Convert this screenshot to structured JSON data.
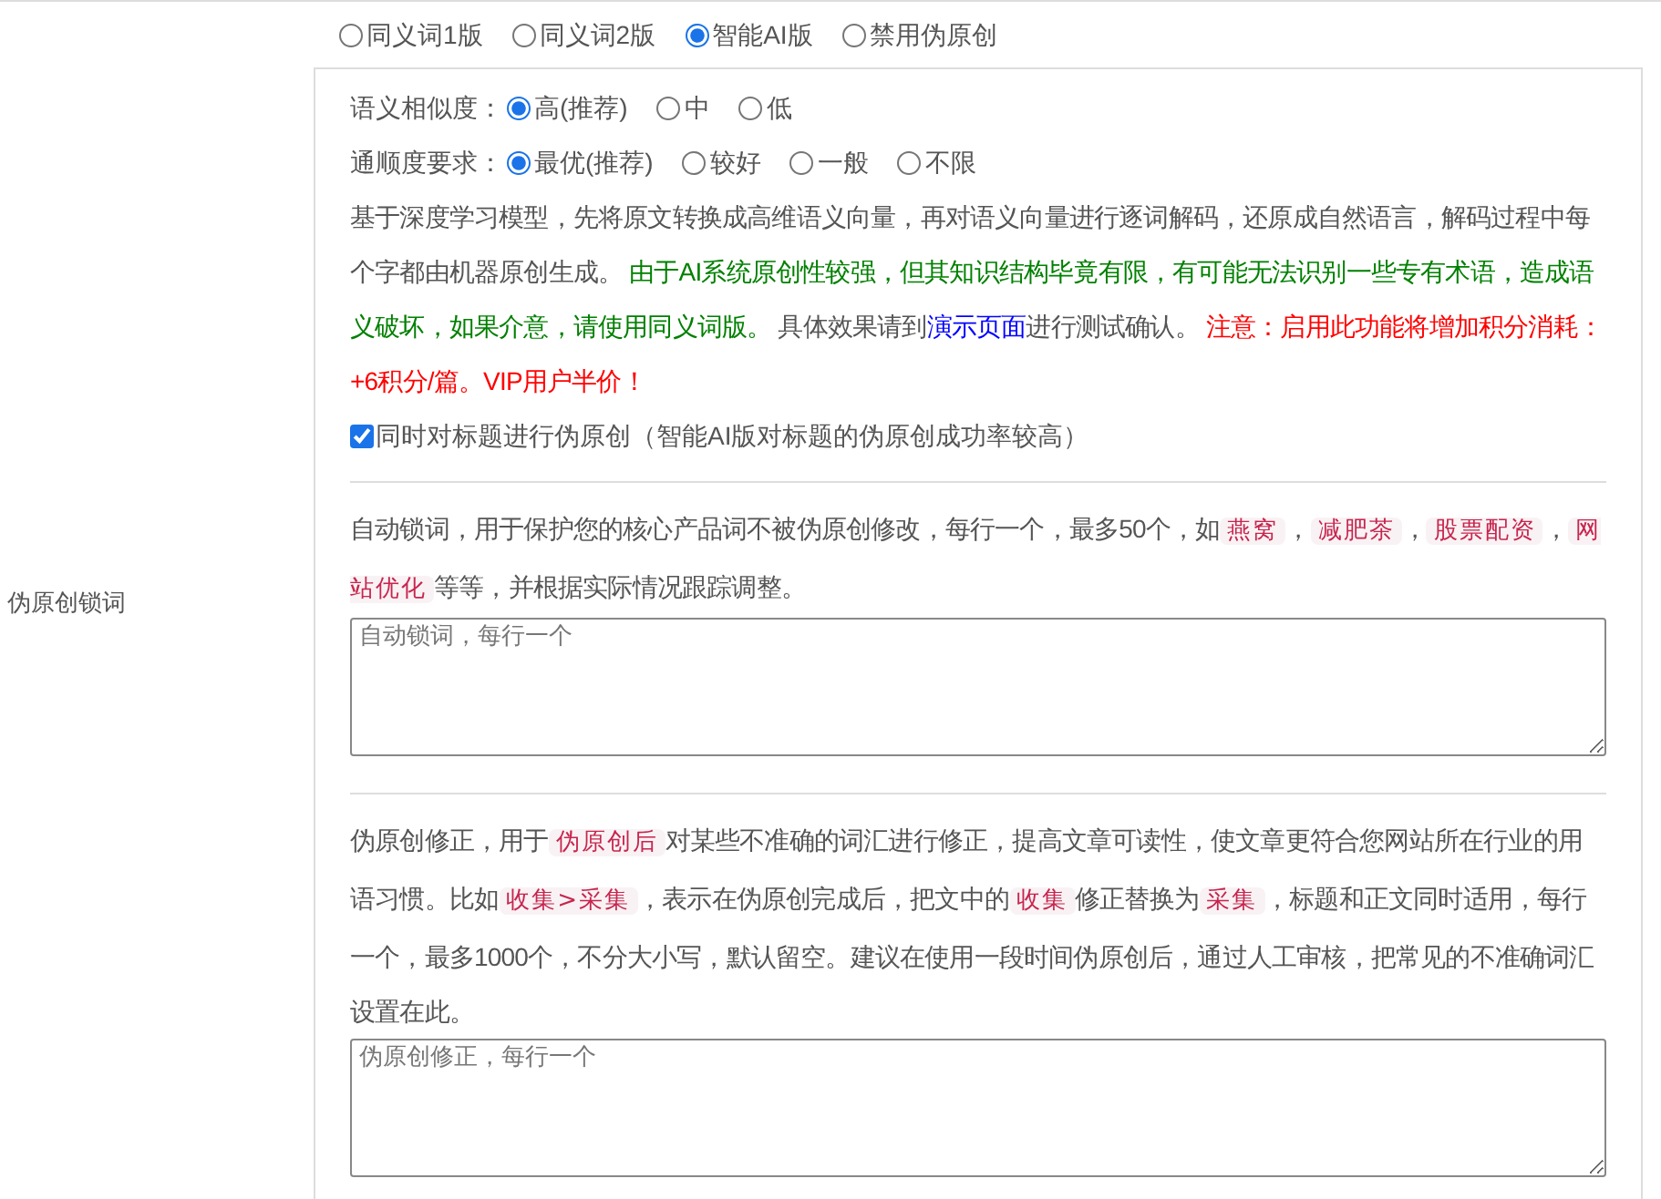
{
  "versions": [
    {
      "label": "同义词1版",
      "selected": false
    },
    {
      "label": "同义词2版",
      "selected": false
    },
    {
      "label": "智能AI版",
      "selected": true
    },
    {
      "label": "禁用伪原创",
      "selected": false
    }
  ],
  "ai_panel": {
    "similarity": {
      "label": "语义相似度：",
      "options": [
        {
          "label": "高(推荐)",
          "selected": true
        },
        {
          "label": "中",
          "selected": false
        },
        {
          "label": "低",
          "selected": false
        }
      ]
    },
    "fluency": {
      "label": "通顺度要求：",
      "options": [
        {
          "label": "最优(推荐)",
          "selected": true
        },
        {
          "label": "较好",
          "selected": false
        },
        {
          "label": "一般",
          "selected": false
        },
        {
          "label": "不限",
          "selected": false
        }
      ]
    },
    "description": [
      {
        "kind": "plain",
        "text": "基于深度学习模型，先将原文转换成高维语义向量，再对语义向量进行逐词解码，还原成自然语言，解码过程中每个字都由机器原创生成。 "
      },
      {
        "kind": "green",
        "text": "由于AI系统原创性较强，但其知识结构毕竟有限，有可能无法识别一些专有术语，造成语义破坏，如果介意，请使用同义词版。"
      },
      {
        "kind": "plain",
        "text": " 具体效果请到"
      },
      {
        "kind": "link",
        "text": "演示页面"
      },
      {
        "kind": "plain",
        "text": "进行测试确认。 "
      },
      {
        "kind": "red",
        "text": "注意：启用此功能将增加积分消耗：+6积分/篇。VIP用户半价！"
      }
    ],
    "title_option": {
      "label": "同时对标题进行伪原创（智能AI版对标题的伪原创成功率较高）",
      "checked": true
    }
  },
  "lock_words": {
    "label": "伪原创锁词",
    "description": [
      {
        "kind": "plain",
        "text": "自动锁词，用于保护您的核心产品词不被伪原创修改，每行一个，最多50个，如"
      },
      {
        "kind": "code",
        "text": "燕窝"
      },
      {
        "kind": "plain",
        "text": "，"
      },
      {
        "kind": "code",
        "text": "减肥茶"
      },
      {
        "kind": "plain",
        "text": "，"
      },
      {
        "kind": "code",
        "text": "股票配资"
      },
      {
        "kind": "plain",
        "text": "，"
      },
      {
        "kind": "code",
        "text": "网站优化"
      },
      {
        "kind": "plain",
        "text": "等等，并根据实际情况跟踪调整。"
      }
    ],
    "placeholder": "自动锁词，每行一个"
  },
  "corrections": {
    "description": [
      {
        "kind": "plain",
        "text": "伪原创修正，用于"
      },
      {
        "kind": "code",
        "text": "伪原创后"
      },
      {
        "kind": "plain",
        "text": "对某些不准确的词汇进行修正，提高文章可读性，使文章更符合您网站所在行业的用语习惯。比如"
      },
      {
        "kind": "code",
        "text": "收集>采集"
      },
      {
        "kind": "plain",
        "text": "，表示在伪原创完成后，把文中的"
      },
      {
        "kind": "code",
        "text": "收集"
      },
      {
        "kind": "plain",
        "text": "修正替换为"
      },
      {
        "kind": "code",
        "text": "采集"
      },
      {
        "kind": "plain",
        "text": "，标题和正文同时适用，每行一个，最多1000个，不分大小写，默认留空。建议在使用一段时间伪原创后，通过人工审核，把常见的不准确词汇设置在此。"
      }
    ],
    "placeholder": "伪原创修正，每行一个"
  }
}
